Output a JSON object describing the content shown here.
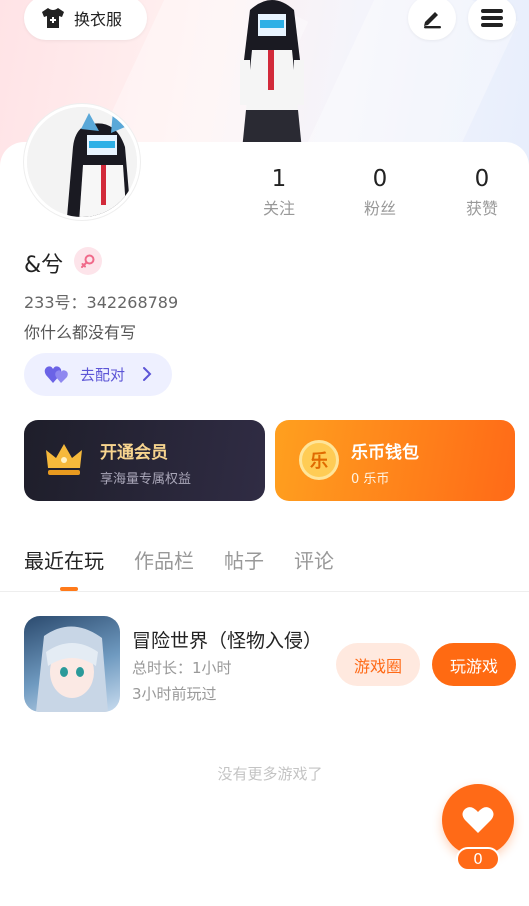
{
  "header": {
    "dress_up_label": "换衣服",
    "edit_icon": "pencil-icon",
    "menu_icon": "menu-icon"
  },
  "profile": {
    "nickname": "&兮",
    "gender": "female",
    "uid_label": "233号：342268789",
    "bio": "你什么都没有写",
    "match_label": "去配对"
  },
  "stats": [
    {
      "value": "1",
      "label": "关注"
    },
    {
      "value": "0",
      "label": "粉丝"
    },
    {
      "value": "0",
      "label": "获赞"
    }
  ],
  "vip_card": {
    "title": "开通会员",
    "subtitle": "享海量专属权益"
  },
  "wallet_card": {
    "coin_glyph": "乐",
    "title": "乐币钱包",
    "subtitle": "0 乐币"
  },
  "tabs": [
    {
      "label": "最近在玩",
      "active": true
    },
    {
      "label": "作品栏",
      "active": false
    },
    {
      "label": "帖子",
      "active": false
    },
    {
      "label": "评论",
      "active": false
    }
  ],
  "recent_games": [
    {
      "title": "冒险世界（怪物入侵）",
      "duration": "总时长：1小时",
      "last_played": "3小时前玩过",
      "circle_label": "游戏圈",
      "play_label": "玩游戏"
    }
  ],
  "no_more_text": "没有更多游戏了",
  "like": {
    "count": "0"
  },
  "colors": {
    "accent": "#ff6a17",
    "match_purple": "#5c55d6",
    "vip_gold": "#f8d58f"
  }
}
